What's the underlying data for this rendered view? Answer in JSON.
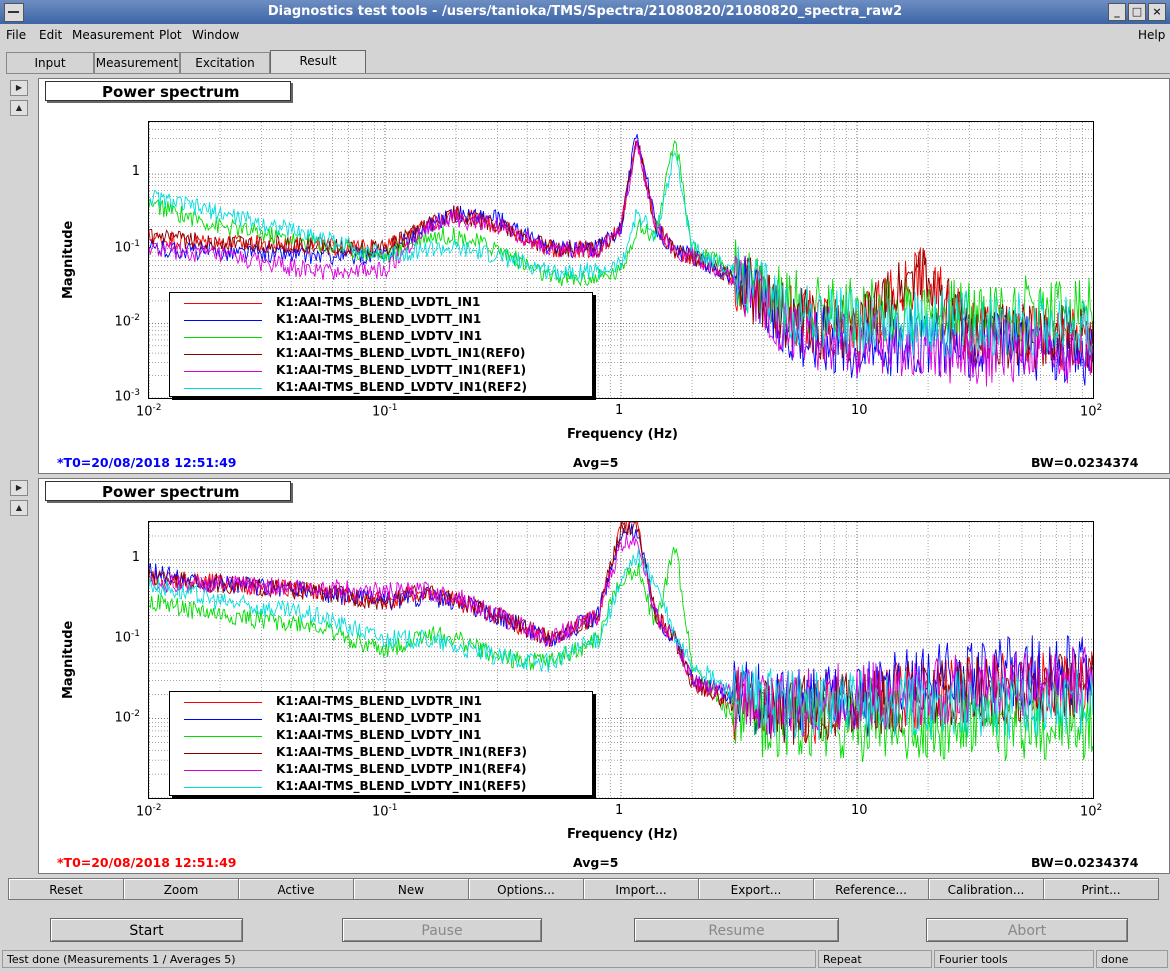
{
  "window": {
    "title": "Diagnostics test tools - /users/tanioka/TMS/Spectra/21080820/21080820_spectra_raw2"
  },
  "menus": {
    "left": [
      "File",
      "Edit",
      "Measurement",
      "Plot",
      "Window"
    ],
    "help": "Help"
  },
  "tabs": [
    "Input",
    "Measurement",
    "Excitation",
    "Result"
  ],
  "active_tab": "Result",
  "toolbar": [
    "Reset",
    "Zoom",
    "Active",
    "New",
    "Options...",
    "Import...",
    "Export...",
    "Reference...",
    "Calibration...",
    "Print..."
  ],
  "controls": {
    "start": "Start",
    "pause": "Pause",
    "resume": "Resume",
    "abort": "Abort"
  },
  "status": {
    "message": "Test done (Measurements 1 / Averages 5)",
    "mode": "Repeat",
    "tool": "Fourier tools",
    "state": "done"
  },
  "colors": {
    "bg": "#d4d4d4",
    "title_bar": "#3d64a6",
    "t0_top": "#0000ff",
    "t0_bottom": "#ff0000"
  },
  "chart_data": [
    {
      "type": "line",
      "title": "Power spectrum",
      "xlabel": "Frequency (Hz)",
      "ylabel": "Magnitude",
      "xscale": "log",
      "yscale": "log",
      "xlim": [
        0.01,
        100
      ],
      "ylim": [
        0.001,
        5
      ],
      "grid": true,
      "legend_position": "bottom-left",
      "xticks": [
        {
          "base": "10",
          "exp": "-2"
        },
        {
          "base": "10",
          "exp": "-1"
        },
        {
          "base": "1",
          "exp": ""
        },
        {
          "base": "10",
          "exp": ""
        },
        {
          "base": "10",
          "exp": "2"
        }
      ],
      "yticks": [
        {
          "base": "1",
          "exp": ""
        },
        {
          "base": "10",
          "exp": "-1"
        },
        {
          "base": "10",
          "exp": "-2"
        },
        {
          "base": "10",
          "exp": "-3"
        }
      ],
      "info": {
        "t0": "*T0=20/08/2018 12:51:49",
        "avg": "Avg=5",
        "bw": "BW=0.0234374"
      },
      "x": [
        0.01,
        0.02,
        0.05,
        0.1,
        0.15,
        0.2,
        0.3,
        0.5,
        0.8,
        1.0,
        1.17,
        1.4,
        1.7,
        2.0,
        3.0,
        5.0,
        10,
        18,
        30,
        50,
        100
      ],
      "series": [
        {
          "name": "K1:AAI-TMS_BLEND_LVDTL_IN1",
          "color": "#ff0000",
          "values": [
            0.14,
            0.12,
            0.11,
            0.1,
            0.2,
            0.3,
            0.2,
            0.1,
            0.1,
            0.2,
            3.0,
            0.2,
            0.09,
            0.08,
            0.04,
            0.012,
            0.007,
            0.05,
            0.007,
            0.007,
            0.006
          ]
        },
        {
          "name": "K1:AAI-TMS_BLEND_LVDTT_IN1",
          "color": "#0000ff",
          "values": [
            0.1,
            0.09,
            0.08,
            0.08,
            0.2,
            0.3,
            0.25,
            0.1,
            0.1,
            0.2,
            4.0,
            0.2,
            0.09,
            0.08,
            0.04,
            0.008,
            0.005,
            0.006,
            0.005,
            0.005,
            0.004
          ]
        },
        {
          "name": "K1:AAI-TMS_BLEND_LVDTV_IN1",
          "color": "#00dd00",
          "values": [
            0.4,
            0.2,
            0.12,
            0.08,
            0.15,
            0.15,
            0.1,
            0.04,
            0.04,
            0.05,
            0.2,
            0.15,
            3.0,
            0.1,
            0.05,
            0.02,
            0.015,
            0.015,
            0.015,
            0.016,
            0.016
          ]
        },
        {
          "name": "K1:AAI-TMS_BLEND_LVDTL_IN1(REF0)",
          "color": "#8b0000",
          "values": [
            0.14,
            0.12,
            0.11,
            0.1,
            0.2,
            0.3,
            0.2,
            0.1,
            0.1,
            0.2,
            3.0,
            0.2,
            0.09,
            0.08,
            0.04,
            0.012,
            0.007,
            0.05,
            0.007,
            0.007,
            0.006
          ]
        },
        {
          "name": "K1:AAI-TMS_BLEND_LVDTT_IN1(REF1)",
          "color": "#dd00dd",
          "values": [
            0.1,
            0.08,
            0.05,
            0.05,
            0.2,
            0.25,
            0.2,
            0.1,
            0.1,
            0.2,
            3.0,
            0.2,
            0.09,
            0.08,
            0.04,
            0.008,
            0.005,
            0.005,
            0.004,
            0.004,
            0.004
          ]
        },
        {
          "name": "K1:AAI-TMS_BLEND_LVDTV_IN1(REF2)",
          "color": "#00dddd",
          "values": [
            0.5,
            0.3,
            0.15,
            0.08,
            0.1,
            0.1,
            0.08,
            0.05,
            0.05,
            0.06,
            0.3,
            0.15,
            2.0,
            0.1,
            0.05,
            0.015,
            0.01,
            0.01,
            0.01,
            0.01,
            0.01
          ]
        }
      ]
    },
    {
      "type": "line",
      "title": "Power spectrum",
      "xlabel": "Frequency (Hz)",
      "ylabel": "Magnitude",
      "xscale": "log",
      "yscale": "log",
      "xlim": [
        0.01,
        100
      ],
      "ylim": [
        0.001,
        3
      ],
      "grid": true,
      "legend_position": "bottom-left",
      "xticks": [
        {
          "base": "10",
          "exp": "-2"
        },
        {
          "base": "10",
          "exp": "-1"
        },
        {
          "base": "1",
          "exp": ""
        },
        {
          "base": "10",
          "exp": ""
        },
        {
          "base": "10",
          "exp": "2"
        }
      ],
      "yticks": [
        {
          "base": "1",
          "exp": ""
        },
        {
          "base": "10",
          "exp": "-1"
        },
        {
          "base": "10",
          "exp": "-2"
        }
      ],
      "info": {
        "t0": "*T0=20/08/2018 12:51:49",
        "avg": "Avg=5",
        "bw": "BW=0.0234374"
      },
      "x": [
        0.01,
        0.02,
        0.05,
        0.1,
        0.15,
        0.2,
        0.3,
        0.5,
        0.8,
        1.0,
        1.17,
        1.4,
        1.7,
        2.0,
        3.0,
        5.0,
        10,
        18,
        30,
        50,
        100
      ],
      "series": [
        {
          "name": "K1:AAI-TMS_BLEND_LVDTR_IN1",
          "color": "#ff0000",
          "values": [
            0.6,
            0.5,
            0.4,
            0.3,
            0.4,
            0.3,
            0.2,
            0.1,
            0.2,
            2.5,
            2.8,
            0.2,
            0.1,
            0.03,
            0.015,
            0.012,
            0.015,
            0.02,
            0.022,
            0.025,
            0.025
          ]
        },
        {
          "name": "K1:AAI-TMS_BLEND_LVDTP_IN1",
          "color": "#0000ff",
          "values": [
            0.7,
            0.5,
            0.4,
            0.3,
            0.35,
            0.3,
            0.2,
            0.1,
            0.2,
            2.0,
            2.5,
            0.2,
            0.1,
            0.03,
            0.02,
            0.015,
            0.02,
            0.03,
            0.035,
            0.04,
            0.04
          ]
        },
        {
          "name": "K1:AAI-TMS_BLEND_LVDTY_IN1",
          "color": "#00dd00",
          "values": [
            0.3,
            0.2,
            0.15,
            0.07,
            0.12,
            0.1,
            0.06,
            0.05,
            0.1,
            0.6,
            0.8,
            0.15,
            1.5,
            0.05,
            0.01,
            0.008,
            0.008,
            0.008,
            0.008,
            0.008,
            0.008
          ]
        },
        {
          "name": "K1:AAI-TMS_BLEND_LVDTR_IN1(REF3)",
          "color": "#8b0000",
          "values": [
            0.6,
            0.5,
            0.4,
            0.3,
            0.4,
            0.3,
            0.2,
            0.1,
            0.2,
            2.5,
            2.8,
            0.2,
            0.1,
            0.03,
            0.015,
            0.012,
            0.015,
            0.02,
            0.022,
            0.025,
            0.025
          ]
        },
        {
          "name": "K1:AAI-TMS_BLEND_LVDTP_IN1(REF4)",
          "color": "#dd00dd",
          "values": [
            0.5,
            0.5,
            0.45,
            0.4,
            0.4,
            0.35,
            0.2,
            0.1,
            0.2,
            1.5,
            2.0,
            0.2,
            0.1,
            0.03,
            0.02,
            0.015,
            0.02,
            0.02,
            0.025,
            0.03,
            0.03
          ]
        },
        {
          "name": "K1:AAI-TMS_BLEND_LVDTY_IN1(REF5)",
          "color": "#00dddd",
          "values": [
            0.5,
            0.3,
            0.2,
            0.1,
            0.1,
            0.08,
            0.06,
            0.05,
            0.1,
            0.5,
            1.2,
            0.5,
            0.1,
            0.05,
            0.02,
            0.015,
            0.015,
            0.015,
            0.015,
            0.015,
            0.015
          ]
        }
      ]
    }
  ]
}
